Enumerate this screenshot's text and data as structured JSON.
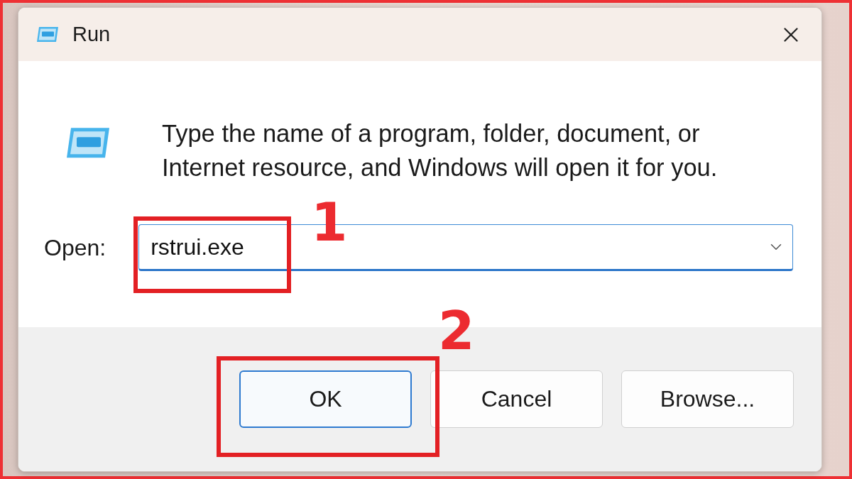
{
  "window": {
    "title": "Run"
  },
  "description": {
    "lines": [
      "Type the name of a program, folder, document, or",
      "Internet resource, and Windows will open it for you."
    ]
  },
  "open_field": {
    "label": "Open:",
    "value": "rstrui.exe"
  },
  "buttons": [
    {
      "label": "OK",
      "default": true
    },
    {
      "label": "Cancel",
      "default": false
    },
    {
      "label": "Browse...",
      "default": false
    }
  ],
  "annotations": [
    {
      "label": "1"
    },
    {
      "label": "2"
    }
  ]
}
